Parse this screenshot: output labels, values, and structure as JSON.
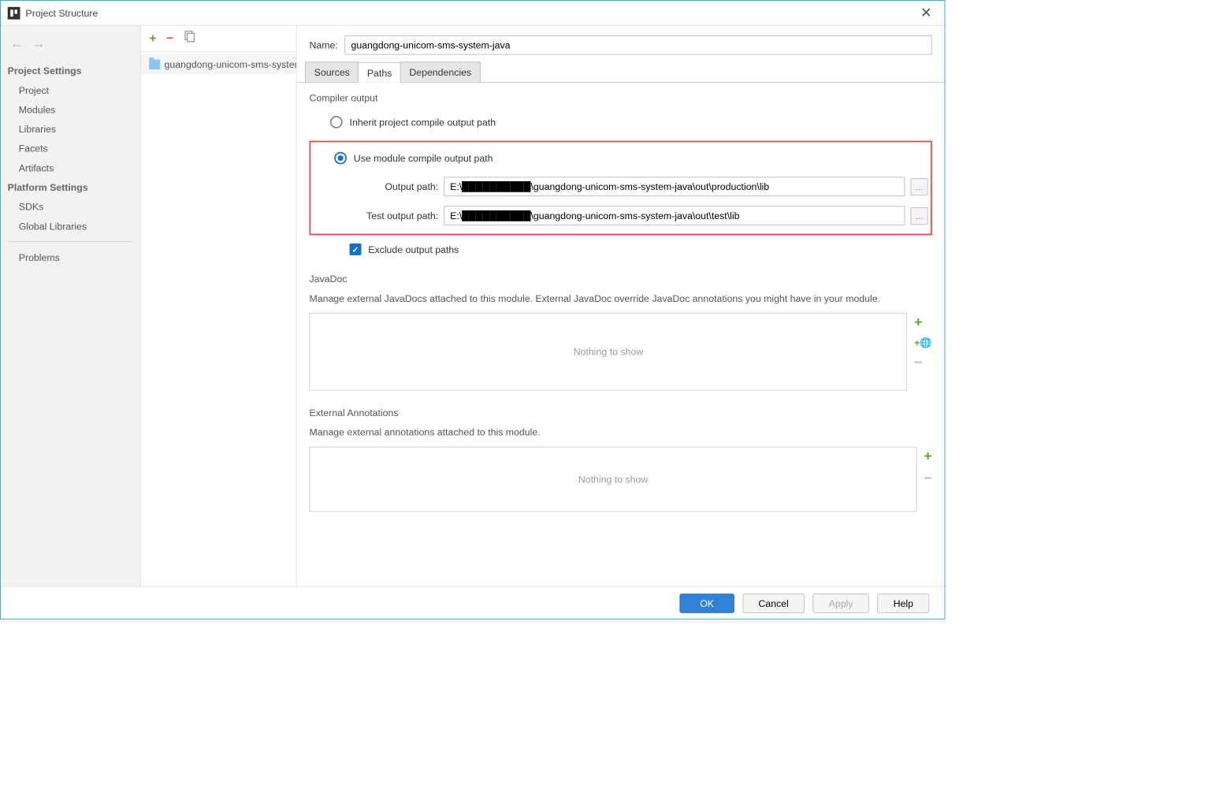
{
  "window": {
    "title": "Project Structure"
  },
  "sidebar": {
    "section1": "Project Settings",
    "items1": [
      "Project",
      "Modules",
      "Libraries",
      "Facets",
      "Artifacts"
    ],
    "section2": "Platform Settings",
    "items2": [
      "SDKs",
      "Global Libraries"
    ],
    "problems": "Problems"
  },
  "module_tree": {
    "selected": "guangdong-unicom-sms-system-java"
  },
  "name": {
    "label": "Name:",
    "value": "guangdong-unicom-sms-system-java"
  },
  "tabs": {
    "sources": "Sources",
    "paths": "Paths",
    "dependencies": "Dependencies"
  },
  "compiler": {
    "heading": "Compiler output",
    "inherit": "Inherit project compile output path",
    "use_module": "Use module compile output path",
    "output_label": "Output path:",
    "output_value": "E:\\██████████\\guangdong-unicom-sms-system-java\\out\\production\\lib",
    "test_label": "Test output path:",
    "test_value": "E:\\██████████\\guangdong-unicom-sms-system-java\\out\\test\\lib",
    "exclude": "Exclude output paths",
    "browse": "..."
  },
  "javadoc": {
    "heading": "JavaDoc",
    "desc": "Manage external JavaDocs attached to this module. External JavaDoc override JavaDoc annotations you might have in your module.",
    "empty": "Nothing to show"
  },
  "annotations": {
    "heading": "External Annotations",
    "desc": "Manage external annotations attached to this module.",
    "empty": "Nothing to show"
  },
  "footer": {
    "ok": "OK",
    "cancel": "Cancel",
    "apply": "Apply",
    "help": "Help"
  }
}
